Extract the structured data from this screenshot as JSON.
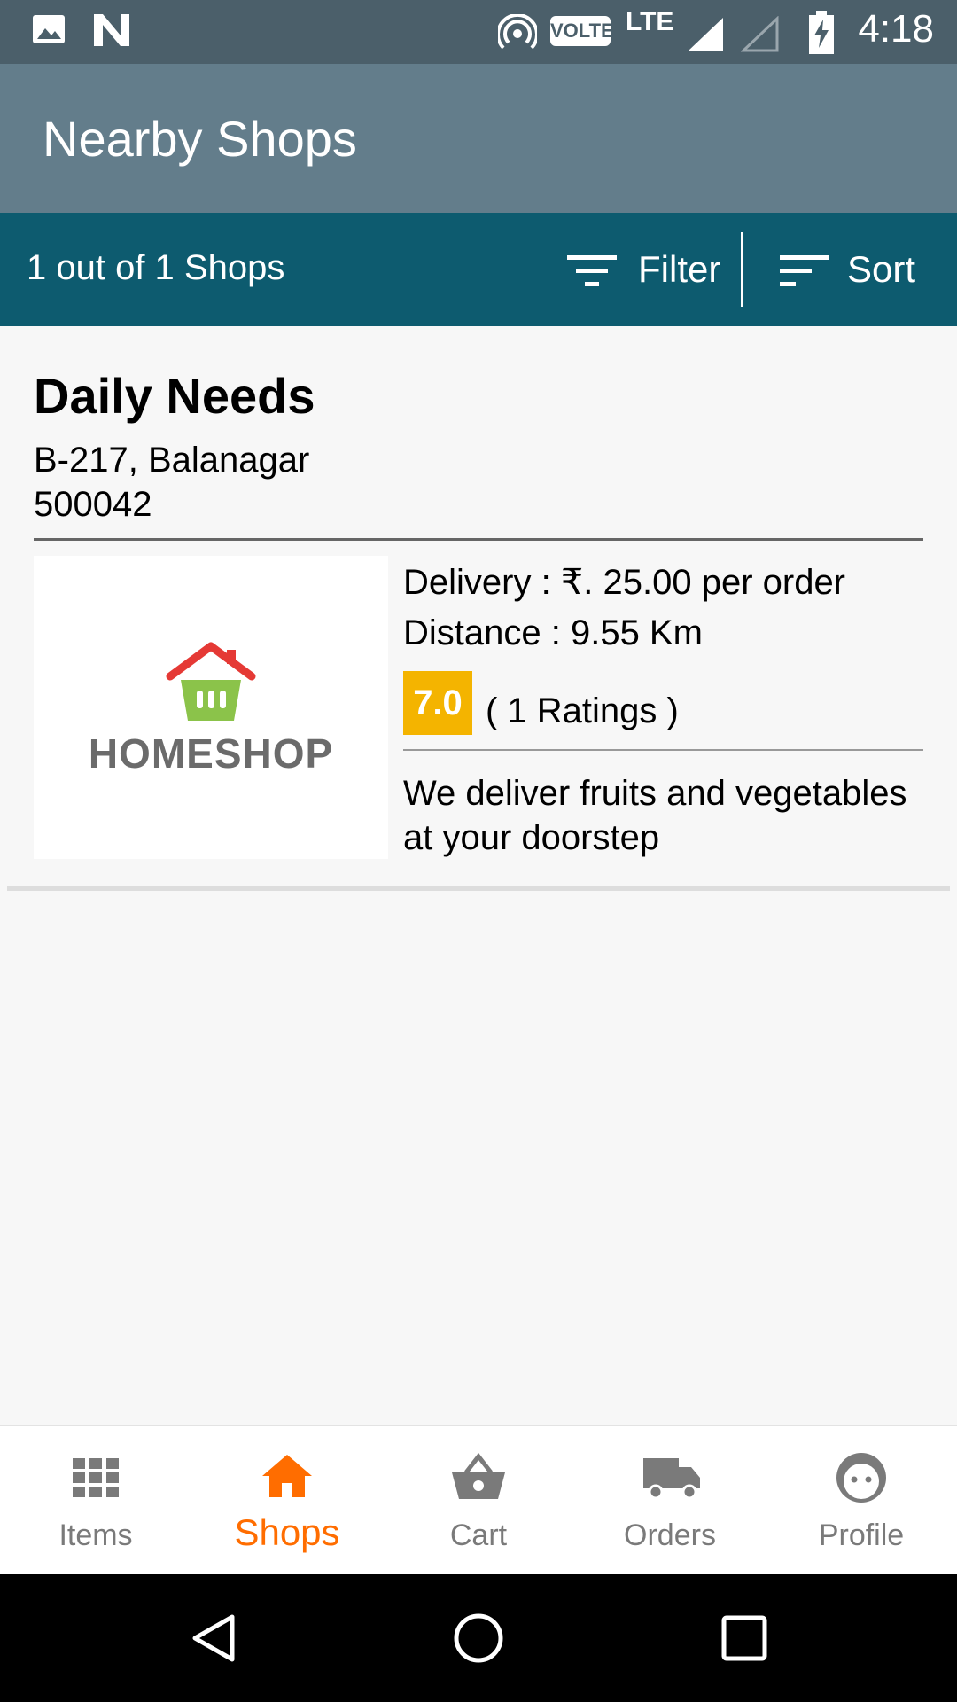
{
  "status_bar": {
    "time": "4:18",
    "volte": "VOLTE",
    "network": "LTE",
    "icons": [
      "image-icon",
      "n-icon",
      "hotspot-icon",
      "signal-icon",
      "signal-empty-icon",
      "battery-charging-icon"
    ]
  },
  "app_bar": {
    "title": "Nearby Shops"
  },
  "toolbar": {
    "count_text": "1 out of 1 Shops",
    "filter_label": "Filter",
    "sort_label": "Sort"
  },
  "shops": [
    {
      "name": "Daily Needs",
      "address_line1": "B-217, Balanagar",
      "address_line2": "500042",
      "logo_text": "HOMESHOP",
      "delivery": "Delivery : ₹. 25.00 per order",
      "distance": "Distance : 9.55 Km",
      "rating": "7.0",
      "ratings_count": "( 1 Ratings )",
      "description": "We deliver fruits and vegetables at your doorstep"
    }
  ],
  "bottom_nav": {
    "items": [
      {
        "label": "Items",
        "icon": "grid-icon",
        "active": false
      },
      {
        "label": "Shops",
        "icon": "store-icon",
        "active": true
      },
      {
        "label": "Cart",
        "icon": "basket-icon",
        "active": false
      },
      {
        "label": "Orders",
        "icon": "truck-icon",
        "active": false
      },
      {
        "label": "Profile",
        "icon": "face-icon",
        "active": false
      }
    ]
  },
  "colors": {
    "status_bar": "#4b5f6a",
    "app_bar": "#637d8b",
    "toolbar": "#0d5b6f",
    "accent": "#ff6d00",
    "rating_badge": "#f4b400"
  }
}
